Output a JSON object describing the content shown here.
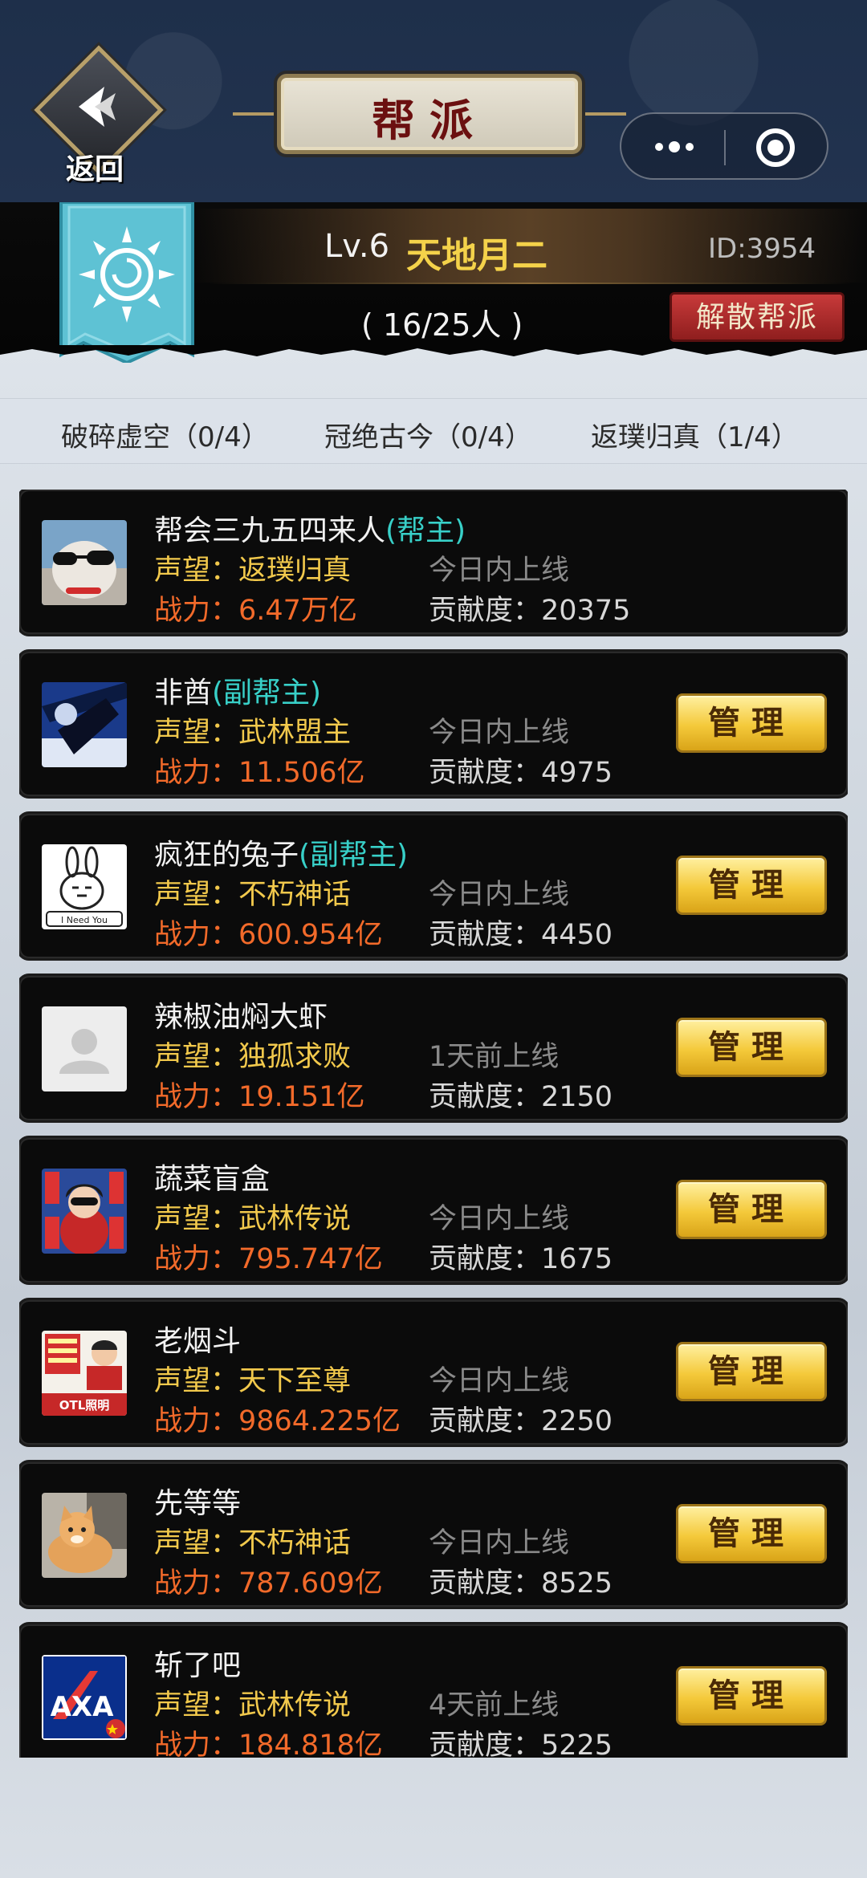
{
  "header": {
    "back_label": "返回",
    "title": "帮派"
  },
  "guild": {
    "level": "Lv.6",
    "name": "天地月二",
    "id": "ID:3954",
    "count": "( 16/25人 )",
    "disband_label": "解散帮派"
  },
  "tiers": [
    {
      "label": "破碎虚空（0/4）"
    },
    {
      "label": "冠绝古今（0/4）"
    },
    {
      "label": "返璞归真（1/4）"
    }
  ],
  "members": [
    {
      "name": "帮会三九五四来人",
      "role": "(帮主)",
      "fame": "声望：返璞归真",
      "power": "战力：6.47万亿",
      "online": "今日内上线",
      "contrib": "贡献度：20375",
      "manage": ""
    },
    {
      "name": "非酋",
      "role": "(副帮主)",
      "fame": "声望：武林盟主",
      "power": "战力：11.506亿",
      "online": "今日内上线",
      "contrib": "贡献度：4975",
      "manage": "管理"
    },
    {
      "name": "疯狂的兔子",
      "role": "(副帮主)",
      "fame": "声望：不朽神话",
      "power": "战力：600.954亿",
      "online": "今日内上线",
      "contrib": "贡献度：4450",
      "manage": "管理"
    },
    {
      "name": "辣椒油焖大虾",
      "role": "",
      "fame": "声望：独孤求败",
      "power": "战力：19.151亿",
      "online": "1天前上线",
      "contrib": "贡献度：2150",
      "manage": "管理"
    },
    {
      "name": "蔬菜盲盒",
      "role": "",
      "fame": "声望：武林传说",
      "power": "战力：795.747亿",
      "online": "今日内上线",
      "contrib": "贡献度：1675",
      "manage": "管理"
    },
    {
      "name": "老烟斗",
      "role": "",
      "fame": "声望：天下至尊",
      "power": "战力：9864.225亿",
      "online": "今日内上线",
      "contrib": "贡献度：2250",
      "manage": "管理"
    },
    {
      "name": "先等等",
      "role": "",
      "fame": "声望：不朽神话",
      "power": "战力：787.609亿",
      "online": "今日内上线",
      "contrib": "贡献度：8525",
      "manage": "管理"
    },
    {
      "name": "斩了吧",
      "role": "",
      "fame": "声望：武林传说",
      "power": "战力：184.818亿",
      "online": "4天前上线",
      "contrib": "贡献度：5225",
      "manage": "管理"
    }
  ],
  "avatar_texts": {
    "rabbit": "I Need You",
    "otl": "OTL照明",
    "axa": "AXA"
  }
}
